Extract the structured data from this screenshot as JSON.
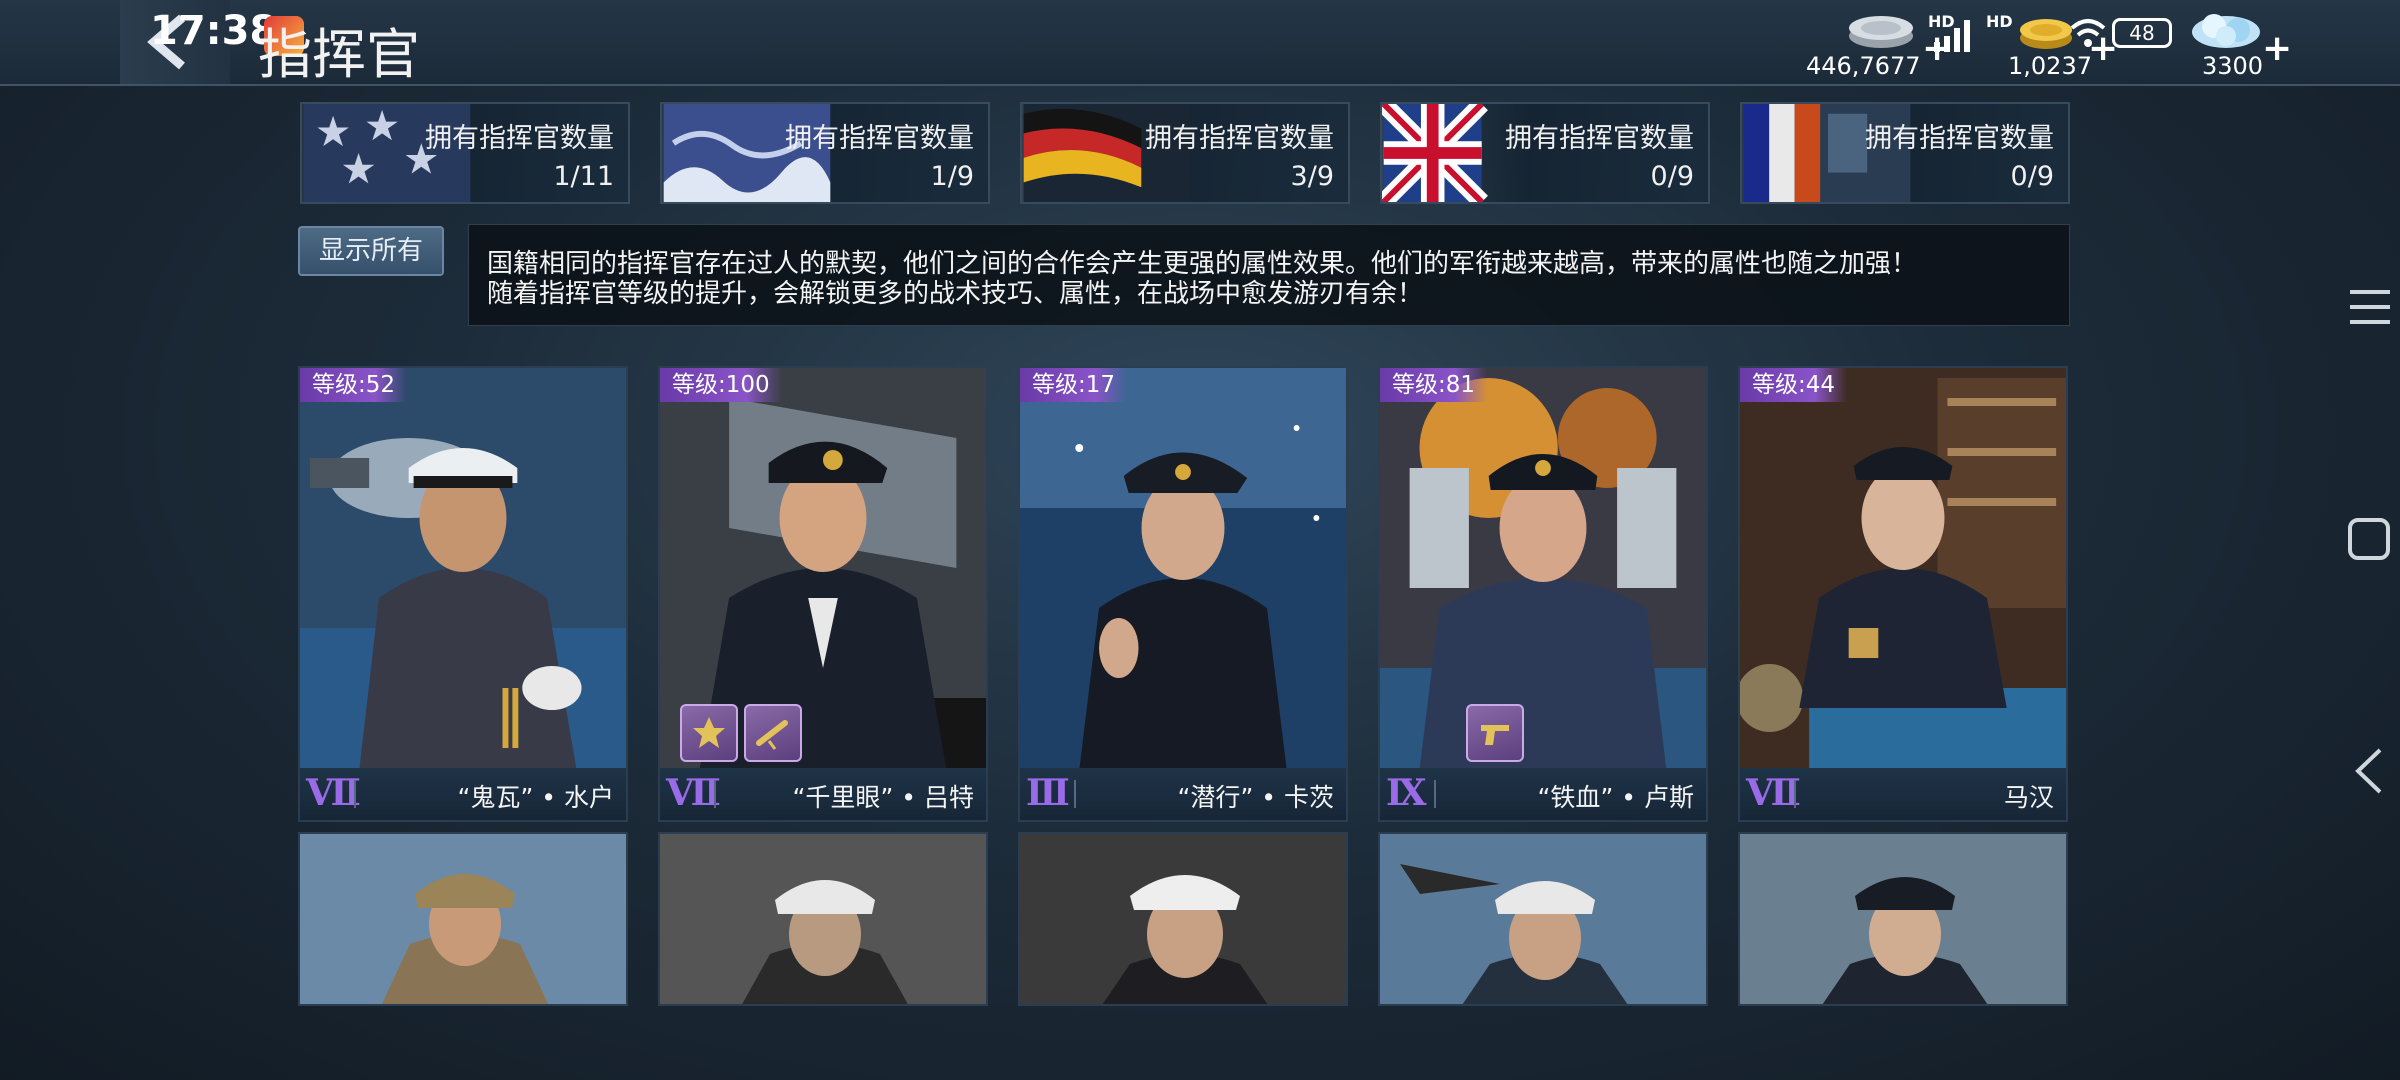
{
  "status_bar": {
    "time": "17:38",
    "signal_hd_1": "HD",
    "signal_hd_2": "HD",
    "battery": "48"
  },
  "header": {
    "title": "指挥官"
  },
  "resources": [
    {
      "icon": "silver-coin-icon",
      "value": "446,7677"
    },
    {
      "icon": "gold-coin-icon",
      "value": "1,0237"
    },
    {
      "icon": "diamond-icon",
      "value": "3300"
    }
  ],
  "nations": [
    {
      "label": "拥有指挥官数量",
      "count": "1/11",
      "flag": "usa-flag"
    },
    {
      "label": "拥有指挥官数量",
      "count": "1/9",
      "flag": "japan-flag"
    },
    {
      "label": "拥有指挥官数量",
      "count": "3/9",
      "flag": "germany-flag"
    },
    {
      "label": "拥有指挥官数量",
      "count": "0/9",
      "flag": "uk-flag"
    },
    {
      "label": "拥有指挥官数量",
      "count": "0/9",
      "flag": "other-flag"
    }
  ],
  "filter": {
    "show_all_label": "显示所有"
  },
  "description": {
    "line1": "国籍相同的指挥官存在过人的默契，他们之间的合作会产生更强的属性效果。他们的军衔越来越高，带来的属性也随之加强！",
    "line2": "随着指挥官等级的提升，会解锁更多的战术技巧、属性，在战场中愈发游刃有余！"
  },
  "commanders": [
    {
      "level": "等级:52",
      "rank": "Ⅶ",
      "name": "“鬼瓦” • 水户",
      "skills": []
    },
    {
      "level": "等级:100",
      "rank": "Ⅶ",
      "name": "“千里眼” • 吕特",
      "skills": [
        "medal-icon",
        "telescope-icon"
      ]
    },
    {
      "level": "等级:17",
      "rank": "Ⅲ",
      "name": "“潜行” • 卡茨",
      "skills": []
    },
    {
      "level": "等级:81",
      "rank": "Ⅸ",
      "name": "“铁血” • 卢斯",
      "skills": [
        "pistol-icon"
      ]
    },
    {
      "level": "等级:44",
      "rank": "Ⅶ",
      "name": "马汉",
      "skills": []
    }
  ],
  "colors": {
    "rank_purple": "#9a6be6",
    "level_badge": "#7a48b8",
    "panel_bg": "#1c2a38"
  }
}
